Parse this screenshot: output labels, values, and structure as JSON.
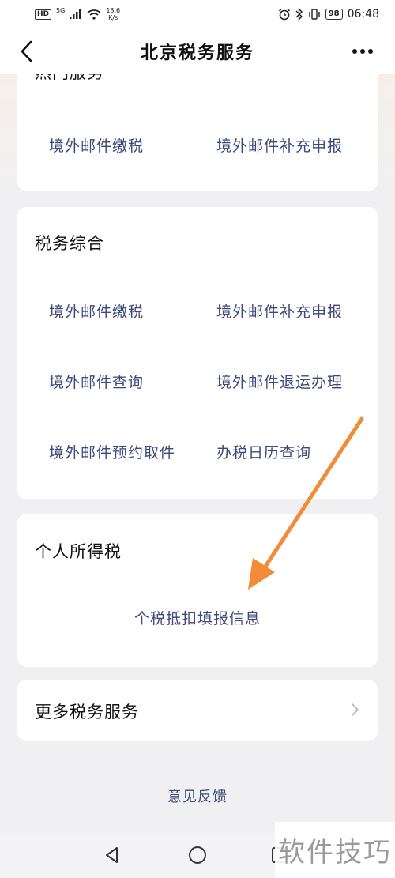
{
  "status_bar": {
    "hd": "HD",
    "signal_gen": "5G",
    "net_speed_value": "13.6",
    "net_speed_unit": "K/s",
    "battery": "98",
    "time": "06:48"
  },
  "header": {
    "title": "北京税务服务"
  },
  "hot_services": {
    "title_partial": "热门服务",
    "items": [
      "境外邮件缴税",
      "境外邮件补充申报"
    ]
  },
  "tax_general": {
    "title": "税务综合",
    "items": [
      "境外邮件缴税",
      "境外邮件补充申报",
      "境外邮件查询",
      "境外邮件退运办理",
      "境外邮件预约取件",
      "办税日历查询"
    ]
  },
  "personal_income_tax": {
    "title": "个人所得税",
    "items": [
      "个税抵扣填报信息"
    ]
  },
  "more_services": {
    "label": "更多税务服务"
  },
  "feedback": {
    "label": "意见反馈"
  },
  "watermark": {
    "text": "软件技巧"
  },
  "colors": {
    "link_blue": "#3c4a7a",
    "arrow_orange": "#f28c38"
  }
}
